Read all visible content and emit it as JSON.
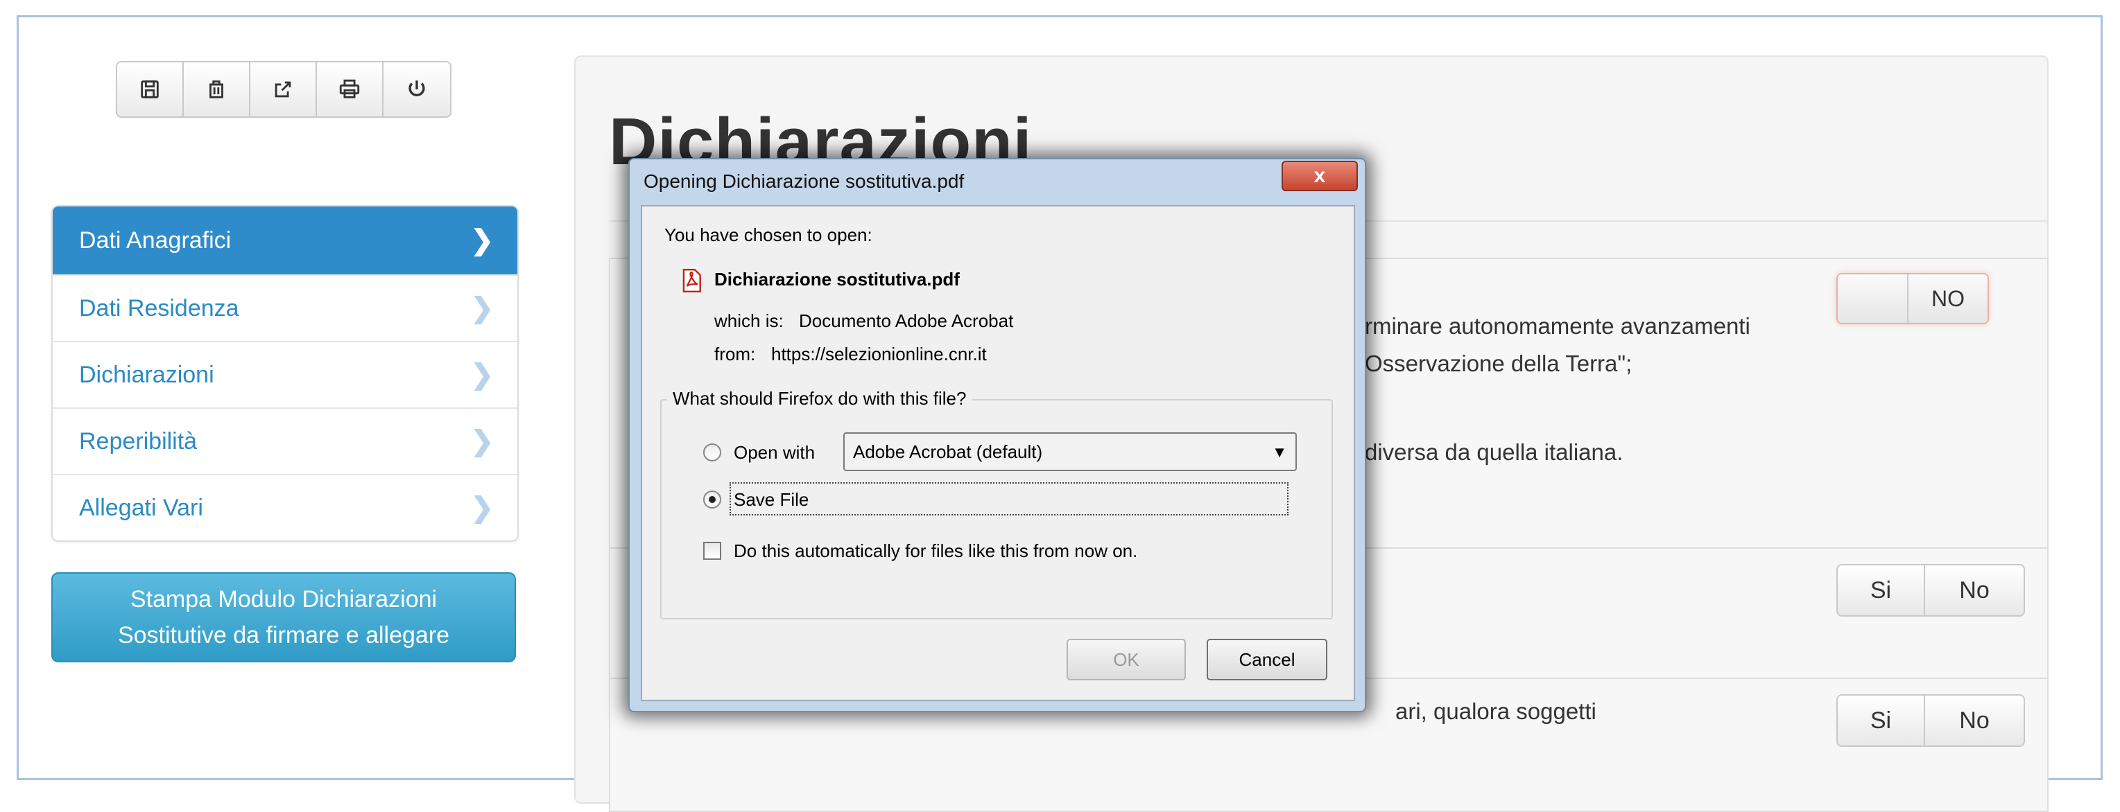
{
  "toolbar": {
    "buttons": [
      {
        "icon": "save-icon"
      },
      {
        "icon": "trash-icon"
      },
      {
        "icon": "share-icon"
      },
      {
        "icon": "print-icon"
      },
      {
        "icon": "power-icon"
      }
    ]
  },
  "sidebar": {
    "items": [
      {
        "label": "Dati Anagrafici",
        "active": true
      },
      {
        "label": "Dati Residenza",
        "active": false
      },
      {
        "label": "Dichiarazioni",
        "active": false
      },
      {
        "label": "Reperibilità",
        "active": false
      },
      {
        "label": "Allegati Vari",
        "active": false
      }
    ],
    "print_button": {
      "line1": "Stampa Modulo Dichiarazioni",
      "line2": "Sostitutive da firmare e allegare"
    }
  },
  "main": {
    "title": "Dichiarazioni",
    "text_fragments": {
      "line1": "rminare autonomamente avanzamenti",
      "line2": "Osservazione della Terra\";",
      "line3": "diversa da quella italiana.",
      "line4": "ari, qualora soggetti"
    },
    "toggle_label": "NO",
    "segments": [
      {
        "si": "Si",
        "no": "No"
      },
      {
        "si": "Si",
        "no": "No"
      }
    ]
  },
  "dialog": {
    "title": "Opening Dichiarazione sostitutiva.pdf",
    "close_symbol": "x",
    "chosen_text": "You have chosen to open:",
    "file_name": "Dichiarazione sostitutiva.pdf",
    "which_is_label": "which is:",
    "which_is_value": "Documento Adobe Acrobat",
    "from_label": "from:",
    "from_value": "https://selezionionline.cnr.it",
    "question": "What should Firefox do with this file?",
    "open_with_label": "Open with",
    "open_with_value": "Adobe Acrobat  (default)",
    "save_file_label": "Save File",
    "selected_option": "save_file",
    "auto_label": "Do this automatically for files like this from now on.",
    "auto_checked": false,
    "ok_label": "OK",
    "cancel_label": "Cancel"
  },
  "colors": {
    "active_menu": "#2f8ccb",
    "menu_text": "#2a8ac6",
    "print_button": "#3fa9d2",
    "dialog_frame": "#c4d6ea",
    "close_button": "#c7452f"
  }
}
